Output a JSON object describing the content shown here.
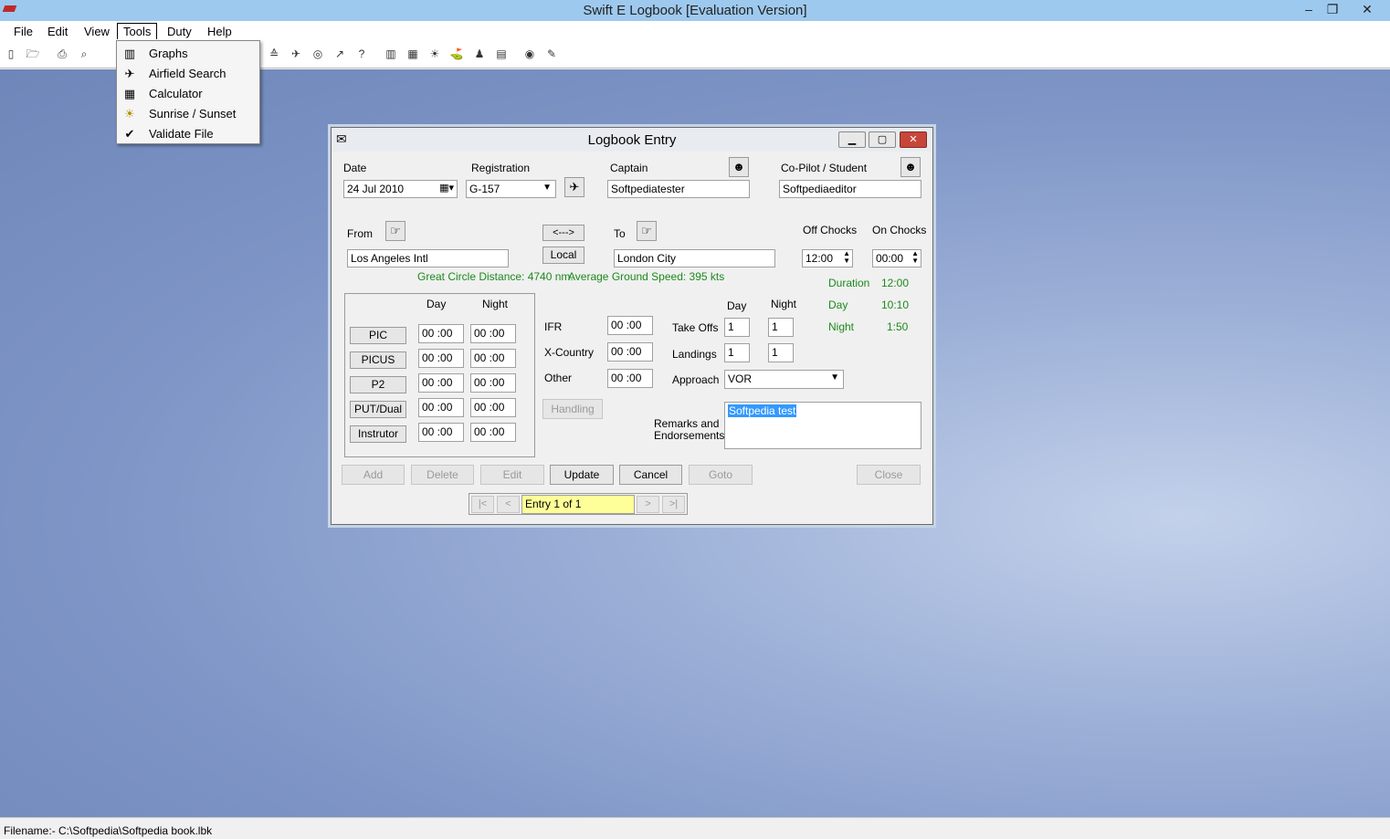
{
  "window": {
    "title": "Swift E Logbook [Evaluation Version]",
    "controls": [
      "–",
      "❐",
      "✕"
    ]
  },
  "menubar": {
    "items": [
      "File",
      "Edit",
      "View",
      "Tools",
      "Duty",
      "Help"
    ]
  },
  "toolbar": {
    "icons": [
      "new-file-icon",
      "open-folder-icon",
      "print-icon",
      "print-preview-icon",
      "cut-icon",
      "chart-icon",
      "plane-icon",
      "ring-icon",
      "arrow-icon",
      "help-icon",
      "bar-chart-icon",
      "calculator-icon",
      "sun-icon",
      "airfield-icon",
      "person-icon",
      "grid-icon",
      "badge-icon",
      "validate-icon"
    ]
  },
  "tools_menu": {
    "items": [
      {
        "label": "Graphs",
        "icon": "bar-chart-icon"
      },
      {
        "label": "Airfield Search",
        "icon": "airfield-search-icon"
      },
      {
        "label": "Calculator",
        "icon": "calculator-icon"
      },
      {
        "label": "Sunrise / Sunset",
        "icon": "sun-icon"
      },
      {
        "label": "Validate File",
        "icon": "validate-file-icon"
      }
    ]
  },
  "dialog": {
    "title": "Logbook Entry",
    "date_label": "Date",
    "date_value": "24  Jul  2010",
    "registration_label": "Registration",
    "registration_value": "G-157",
    "captain_label": "Captain",
    "captain_value": "Softpediatester",
    "copilot_label": "Co-Pilot / Student",
    "copilot_value": "Softpediaeditor",
    "from_label": "From",
    "from_value": "Los Angeles Intl",
    "swap_label": "<--->",
    "local_label": "Local",
    "to_label": "To",
    "to_value": "London City",
    "off_chocks_label": "Off Chocks",
    "off_chocks_value": "12:00",
    "on_chocks_label": "On Chocks",
    "on_chocks_value": "00:00",
    "distance_text": "Great Circle Distance: 4740 nm.",
    "speed_text": "Average Ground Speed: 395 kts",
    "duration_label": "Duration",
    "duration_value": "12:00",
    "day_time_label": "Day",
    "day_time_value": "10:10",
    "night_time_label": "Night",
    "night_time_value": "1:50",
    "time_grid": {
      "col_day": "Day",
      "col_night": "Night",
      "rows": [
        {
          "label": "PIC",
          "day": "00 :00",
          "night": "00 :00"
        },
        {
          "label": "PICUS",
          "day": "00 :00",
          "night": "00 :00"
        },
        {
          "label": "P2",
          "day": "00 :00",
          "night": "00 :00"
        },
        {
          "label": "PUT/Dual",
          "day": "00 :00",
          "night": "00 :00"
        },
        {
          "label": "Instrutor",
          "day": "00 :00",
          "night": "00 :00"
        }
      ]
    },
    "ifr_label": "IFR",
    "ifr_value": "00 :00",
    "xcountry_label": "X-Country",
    "xcountry_value": "00 :00",
    "other_label": "Other",
    "other_value": "00 :00",
    "handling_label": "Handling",
    "tol_day_label": "Day",
    "tol_night_label": "Night",
    "takeoffs_label": "Take Offs",
    "takeoffs_day": "1",
    "takeoffs_night": "1",
    "landings_label": "Landings",
    "landings_day": "1",
    "landings_night": "1",
    "approach_label": "Approach",
    "approach_value": "VOR",
    "remarks_label_1": "Remarks and",
    "remarks_label_2": "Endorsements",
    "remarks_value": "Softpedia test",
    "buttons": {
      "add": "Add",
      "delete": "Delete",
      "edit": "Edit",
      "update": "Update",
      "cancel": "Cancel",
      "goto": "Goto",
      "close": "Close"
    },
    "nav": {
      "first": "|<",
      "prev": "<",
      "entry": "Entry 1 of 1",
      "next": ">",
      "last": ">|"
    }
  },
  "statusbar": {
    "filename": "Filename:- C:\\Softpedia\\Softpedia book.lbk"
  },
  "colors": {
    "titlebar": "#9ec9ee",
    "green_text": "#1b8a1b",
    "entry_field": "#ffff99"
  }
}
